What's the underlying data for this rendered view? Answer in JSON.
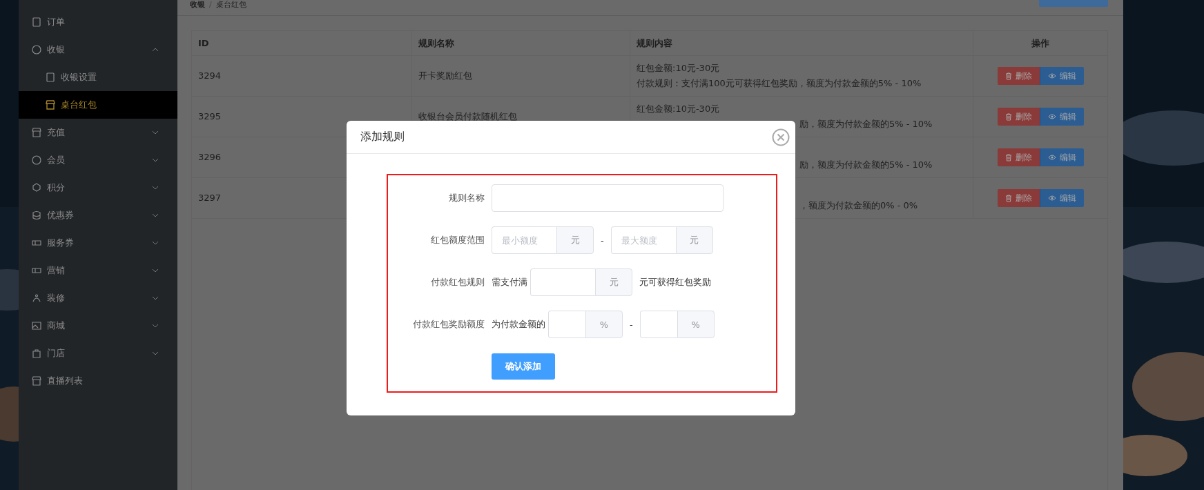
{
  "breadcrumb": {
    "items": [
      "收银",
      "桌台红包"
    ],
    "separator": "/"
  },
  "sidebar": {
    "items": [
      {
        "label": "订单",
        "selected": false
      },
      {
        "label": "收银",
        "selected": false,
        "expanded": true,
        "children": [
          {
            "label": "收银设置",
            "selected": false
          },
          {
            "label": "桌台红包",
            "selected": true
          }
        ]
      },
      {
        "label": "充值",
        "selected": false,
        "expanded": false
      },
      {
        "label": "会员",
        "selected": false,
        "expanded": false
      },
      {
        "label": "积分",
        "selected": false,
        "expanded": false
      },
      {
        "label": "优惠券",
        "selected": false,
        "expanded": false
      },
      {
        "label": "服务券",
        "selected": false,
        "expanded": false
      },
      {
        "label": "营销",
        "selected": false,
        "expanded": false
      },
      {
        "label": "装修",
        "selected": false,
        "expanded": false
      },
      {
        "label": "商城",
        "selected": false,
        "expanded": false
      },
      {
        "label": "门店",
        "selected": false,
        "expanded": false
      },
      {
        "label": "直播列表",
        "selected": false
      }
    ]
  },
  "table": {
    "columns": [
      "ID",
      "规则名称",
      "规则内容",
      "操作"
    ],
    "rows": [
      {
        "id": "3294",
        "name": "开卡奖励红包",
        "content": [
          {
            "text": "红包金额:10元-30元",
            "covered": false
          },
          {
            "text": "付款规则：支付满100元可获得红包奖励，额度为付款金额的5% - 10%",
            "covered": false
          }
        ],
        "actions": [
          "删除",
          "编辑"
        ]
      },
      {
        "id": "3295",
        "name": "收银台会员付款随机红包",
        "content": [
          {
            "text": "红包金额:10元-30元",
            "covered": false
          },
          {
            "text": "励，额度为付款金额的5% - 10%",
            "covered": true
          }
        ],
        "actions": [
          "删除",
          "编辑"
        ]
      },
      {
        "id": "3296",
        "content": [
          {
            "text": "励，额度为付款金额的5% - 10%",
            "covered": true
          }
        ],
        "actions": [
          "删除",
          "编辑"
        ]
      },
      {
        "id": "3297",
        "content": [
          {
            "text": "，额度为付款金额的0% - 0%",
            "covered": true
          }
        ],
        "actions": [
          "删除",
          "编辑"
        ]
      }
    ]
  },
  "modal": {
    "title": "添加规则",
    "form": {
      "rule_name": {
        "label": "规则名称"
      },
      "amount_range": {
        "label": "红包额度范围",
        "min": {
          "placeholder": "最小额度",
          "unit": "元"
        },
        "separator": "-",
        "max": {
          "placeholder": "最大额度",
          "unit": "元"
        }
      },
      "pay_rule": {
        "label": "付款红包规则",
        "prefix": "需支付满",
        "unit": "元",
        "suffix": "元可获得红包奖励"
      },
      "reward": {
        "label": "付款红包奖励额度",
        "prefix": "为付款金额的",
        "min_unit": "%",
        "separator": "-",
        "max_unit": "%"
      },
      "submit": "确认添加"
    }
  }
}
